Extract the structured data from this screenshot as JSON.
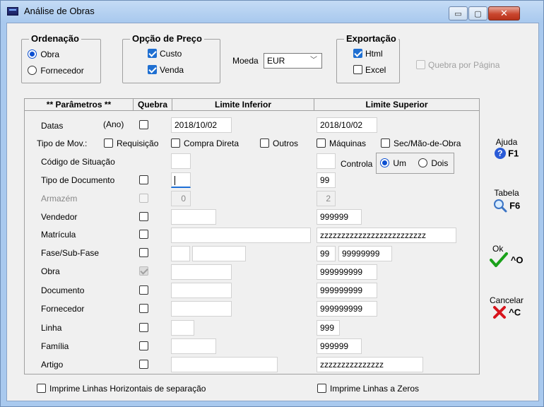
{
  "window": {
    "title": "Análise de Obras",
    "min_glyph": "▭",
    "max_glyph": "▢",
    "close_glyph": "✕"
  },
  "ordenacao": {
    "title": "Ordenação",
    "options": [
      "Obra",
      "Fornecedor"
    ],
    "selected": "Obra"
  },
  "opcao_preco": {
    "title": "Opção de Preço",
    "custo": "Custo",
    "venda": "Venda",
    "custo_checked": true,
    "venda_checked": true
  },
  "moeda": {
    "label": "Moeda",
    "value": "EUR"
  },
  "exportacao": {
    "title": "Exportação",
    "html": "Html",
    "excel": "Excel",
    "html_checked": true,
    "excel_checked": false
  },
  "quebra_pagina": {
    "label": "Quebra por Página",
    "checked": false
  },
  "table": {
    "headers": [
      "** Parâmetros **",
      "Quebra",
      "Limite Inferior",
      "Limite Superior"
    ]
  },
  "rows": {
    "datas": {
      "label": "Datas",
      "sub": "(Ano)",
      "inferior": "2018/10/02",
      "superior": "2018/10/02"
    },
    "tipo_mov": {
      "label": "Tipo de Mov.:",
      "options": [
        "Requisição",
        "Compra Direta",
        "Outros",
        "Máquinas",
        "Sec/Mão-de-Obra"
      ]
    },
    "codigo_situacao": {
      "label": "Código de Situação",
      "controla": "Controla",
      "um": "Um",
      "dois": "Dois",
      "selected": "Um"
    },
    "tipo_documento": {
      "label": "Tipo de Documento",
      "superior": "99"
    },
    "armazem": {
      "label": "Armazém",
      "inferior": "0",
      "superior": "2"
    },
    "vendedor": {
      "label": "Vendedor",
      "superior": "999999"
    },
    "matricula": {
      "label": "Matrícula",
      "superior": "zzzzzzzzzzzzzzzzzzzzzzzzz"
    },
    "fase": {
      "label": "Fase/Sub-Fase",
      "superior_a": "99",
      "superior_b": "99999999"
    },
    "obra": {
      "label": "Obra",
      "superior": "999999999"
    },
    "documento": {
      "label": "Documento",
      "superior": "999999999"
    },
    "fornecedor": {
      "label": "Fornecedor",
      "superior": "999999999"
    },
    "linha": {
      "label": "Linha",
      "superior": "999"
    },
    "familia": {
      "label": "Família",
      "superior": "999999"
    },
    "artigo": {
      "label": "Artigo",
      "superior": "zzzzzzzzzzzzzzz"
    }
  },
  "footer": {
    "linhas_horizontais": "Imprime Linhas Horizontais de separação",
    "linhas_zeros": "Imprime Linhas a Zeros"
  },
  "side": {
    "ajuda": "Ajuda",
    "ajuda_key": "F1",
    "tabela": "Tabela",
    "tabela_key": "F6",
    "ok": "Ok",
    "ok_key": "^O",
    "cancelar": "Cancelar",
    "cancelar_key": "^C"
  },
  "colors": {
    "accent": "#1f6fd1",
    "ok_green": "#1aa11a",
    "cancel_red": "#d8141c",
    "window_frame": "#a9c9ee"
  }
}
